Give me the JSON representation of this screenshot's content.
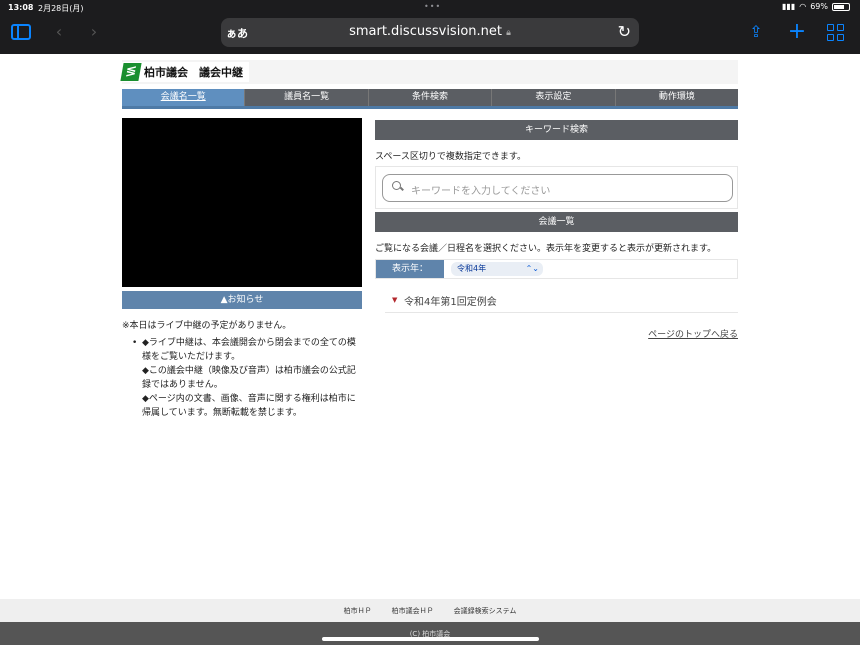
{
  "status_bar": {
    "time": "13:08",
    "date": "2月28日(月)",
    "battery": "69%"
  },
  "browser": {
    "text_size_label": "ぁあ",
    "url": "smart.discussvision.net"
  },
  "site": {
    "logo_text": "柏市議会　議会中継",
    "logo_color": "#1a8f2f"
  },
  "nav": {
    "items": [
      {
        "label": "会議名一覧",
        "active": true
      },
      {
        "label": "議員名一覧",
        "active": false
      },
      {
        "label": "条件検索",
        "active": false
      },
      {
        "label": "表示設定",
        "active": false
      },
      {
        "label": "動作環境",
        "active": false
      }
    ]
  },
  "notice": {
    "header": "▲お知らせ",
    "main_text": "※本日はライブ中継の予定がありません。",
    "lines": [
      "◆ライブ中継は、本会議開会から閉会までの全ての模様をご覧いただけます。",
      "◆この議会中継（映像及び音声）は柏市議会の公式記録ではありません。",
      "◆ページ内の文書、画像、音声に関する権利は柏市に帰属しています。無断転載を禁じます。"
    ]
  },
  "keyword": {
    "header": "キーワード検索",
    "note": "スペース区切りで複数指定できます。",
    "placeholder": "キーワードを入力してください"
  },
  "meetings": {
    "header": "会議一覧",
    "note": "ご覧になる会議／日程名を選択ください。表示年を変更すると表示が更新されます。",
    "year_label": "表示年：",
    "year_value": "令和4年",
    "sessions": [
      "令和4年第1回定例会"
    ],
    "top_link": "ページのトップへ戻る"
  },
  "footer": {
    "links": [
      "柏市ＨＰ",
      "柏市議会ＨＰ",
      "会議録検索システム"
    ],
    "copyright": "(C) 柏市議会"
  }
}
